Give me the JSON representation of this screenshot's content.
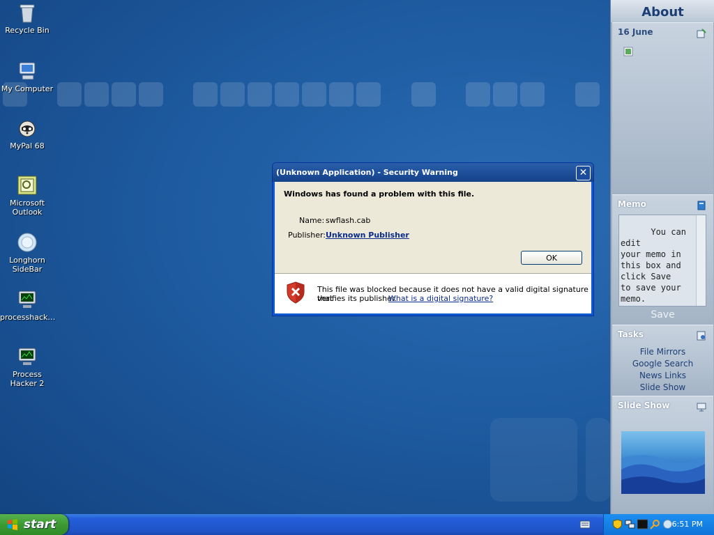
{
  "desktop": {
    "icons": [
      {
        "label": "Recycle Bin",
        "icon": "recycle-bin-icon"
      },
      {
        "label": "My Computer",
        "icon": "computer-icon"
      },
      {
        "label": "MyPal 68",
        "icon": "raccoon-icon"
      },
      {
        "label": "Microsoft Outlook",
        "icon": "outlook-icon"
      },
      {
        "label": "Longhorn SideBar",
        "icon": "sidebar-icon"
      },
      {
        "label": "processhack…",
        "icon": "monitor-icon"
      },
      {
        "label": "Process Hacker 2",
        "icon": "monitor-icon"
      }
    ]
  },
  "sidebar": {
    "title": "About",
    "calendar": {
      "date": "16 June"
    },
    "memo": {
      "title": "Memo",
      "text": "You can edit\nyour memo in\nthis box and\nclick Save\nto save your\nmemo.",
      "save_label": "Save"
    },
    "tasks": {
      "title": "Tasks",
      "items": [
        "File Mirrors",
        "Google Search",
        "News Links",
        "Slide Show"
      ]
    },
    "slideshow": {
      "title": "Slide Show"
    }
  },
  "dialog": {
    "title": "(Unknown Application) - Security Warning",
    "close": "✕",
    "headline": "Windows has found a problem with this file.",
    "name_label": "Name:",
    "name_value": "swflash.cab",
    "publisher_label": "Publisher:",
    "publisher_value": "Unknown Publisher",
    "ok_label": "OK",
    "warning_text": "This file was blocked because it does not have a valid digital signature that",
    "warning_text2": "verifies its publisher.",
    "warning_link": "What is a digital signature?"
  },
  "taskbar": {
    "start_label": "start",
    "time": "6:51 PM"
  },
  "colors": {
    "desktop": "#1e5ba0",
    "taskbar": "#245edb",
    "start": "#3c9a33",
    "dialog_title": "#14418a"
  }
}
